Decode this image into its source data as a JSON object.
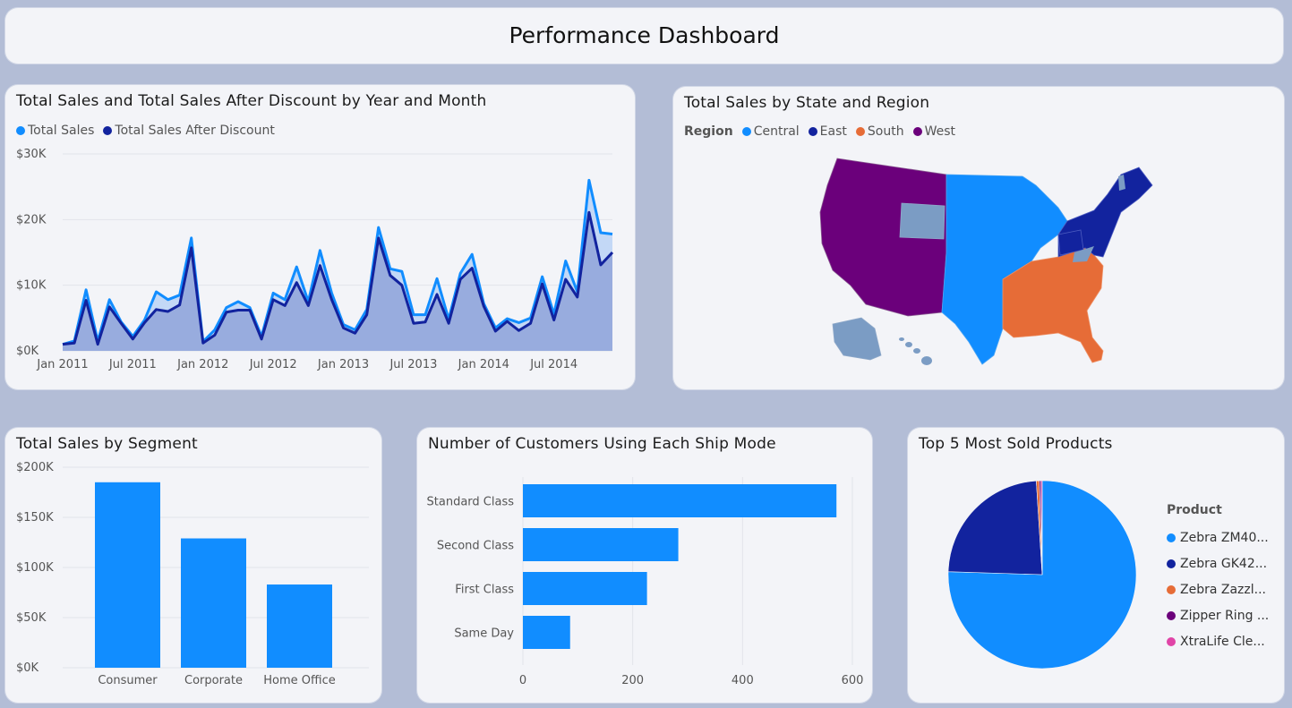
{
  "header": {
    "title": "Performance Dashboard"
  },
  "colors": {
    "total_sales": "#118dff",
    "after_discount": "#12239e",
    "central": "#118dff",
    "east": "#12239e",
    "south": "#e66c37",
    "west": "#6b007b",
    "unassigned": "#7b9cc4",
    "xtralife": "#e044a7"
  },
  "line_chart": {
    "title": "Total Sales and Total Sales After Discount by Year and Month",
    "legend": [
      "Total Sales",
      "Total Sales After Discount"
    ],
    "y_ticks": [
      "$30K",
      "$20K",
      "$10K",
      "$0K"
    ],
    "x_ticks": [
      "Jan 2011",
      "Jul 2011",
      "Jan 2012",
      "Jul 2012",
      "Jan 2013",
      "Jul 2013",
      "Jan 2014",
      "Jul 2014"
    ]
  },
  "map_chart": {
    "title": "Total Sales by State and Region",
    "legend_title": "Region",
    "legend": [
      "Central",
      "East",
      "South",
      "West"
    ]
  },
  "segment_chart": {
    "title": "Total Sales by Segment",
    "y_ticks": [
      "$200K",
      "$150K",
      "$100K",
      "$50K",
      "$0K"
    ]
  },
  "ship_chart": {
    "title": "Number of Customers Using Each Ship Mode",
    "x_ticks": [
      "0",
      "200",
      "400",
      "600"
    ]
  },
  "pie_chart": {
    "title": "Top 5 Most Sold Products",
    "legend_title": "Product",
    "legend": [
      "Zebra ZM40...",
      "Zebra GK42...",
      "Zebra Zazzl...",
      "Zipper Ring ...",
      "XtraLife Cle..."
    ]
  },
  "chart_data": [
    {
      "type": "area",
      "title": "Total Sales and Total Sales After Discount by Year and Month",
      "x": [
        "2011-01",
        "2011-02",
        "2011-03",
        "2011-04",
        "2011-05",
        "2011-06",
        "2011-07",
        "2011-08",
        "2011-09",
        "2011-10",
        "2011-11",
        "2011-12",
        "2012-01",
        "2012-02",
        "2012-03",
        "2012-04",
        "2012-05",
        "2012-06",
        "2012-07",
        "2012-08",
        "2012-09",
        "2012-10",
        "2012-11",
        "2012-12",
        "2013-01",
        "2013-02",
        "2013-03",
        "2013-04",
        "2013-05",
        "2013-06",
        "2013-07",
        "2013-08",
        "2013-09",
        "2013-10",
        "2013-11",
        "2013-12",
        "2014-01",
        "2014-02",
        "2014-03",
        "2014-04",
        "2014-05",
        "2014-06",
        "2014-07",
        "2014-08",
        "2014-09",
        "2014-10",
        "2014-11",
        "2014-12"
      ],
      "series": [
        {
          "name": "Total Sales",
          "values": [
            1000,
            1500,
            9300,
            1500,
            7800,
            4400,
            2200,
            4700,
            9000,
            7800,
            8500,
            17200,
            1400,
            3200,
            6600,
            7500,
            6600,
            2200,
            8800,
            7800,
            12800,
            7500,
            15300,
            8800,
            4000,
            3200,
            6300,
            18800,
            12500,
            12100,
            5500,
            5500,
            11000,
            4800,
            11800,
            14700,
            7200,
            3500,
            4900,
            4300,
            5000,
            11300,
            5600,
            13700,
            9000,
            26000,
            18000,
            17800
          ]
        },
        {
          "name": "Total Sales After Discount",
          "values": [
            1000,
            1200,
            7700,
            1000,
            6700,
            4200,
            1800,
            4300,
            6300,
            6000,
            7000,
            15700,
            1200,
            2400,
            5900,
            6200,
            6200,
            1800,
            7800,
            6900,
            10400,
            6900,
            13000,
            7800,
            3500,
            2700,
            5500,
            17200,
            11500,
            10000,
            4200,
            4400,
            8600,
            4200,
            10900,
            12600,
            6800,
            3000,
            4500,
            3100,
            4200,
            10200,
            4700,
            10900,
            8200,
            21100,
            13100,
            15000
          ]
        }
      ],
      "ylabel": "",
      "ylim": [
        0,
        30000
      ]
    },
    {
      "type": "bar",
      "title": "Total Sales by Segment",
      "categories": [
        "Consumer",
        "Corporate",
        "Home Office"
      ],
      "values": [
        185000,
        129000,
        83000
      ],
      "ylim": [
        0,
        200000
      ]
    },
    {
      "type": "bar",
      "orientation": "horizontal",
      "title": "Number of Customers Using Each Ship Mode",
      "categories": [
        "Standard Class",
        "Second Class",
        "First Class",
        "Same Day"
      ],
      "values": [
        571,
        283,
        226,
        86
      ],
      "xlim": [
        0,
        600
      ]
    },
    {
      "type": "pie",
      "title": "Top 5 Most Sold Products",
      "categories": [
        "Zebra ZM40...",
        "Zebra GK42...",
        "Zebra Zazzl...",
        "Zipper Ring ...",
        "XtraLife Cle..."
      ],
      "values": [
        75.5,
        23.5,
        0.5,
        0.3,
        0.2
      ]
    }
  ]
}
